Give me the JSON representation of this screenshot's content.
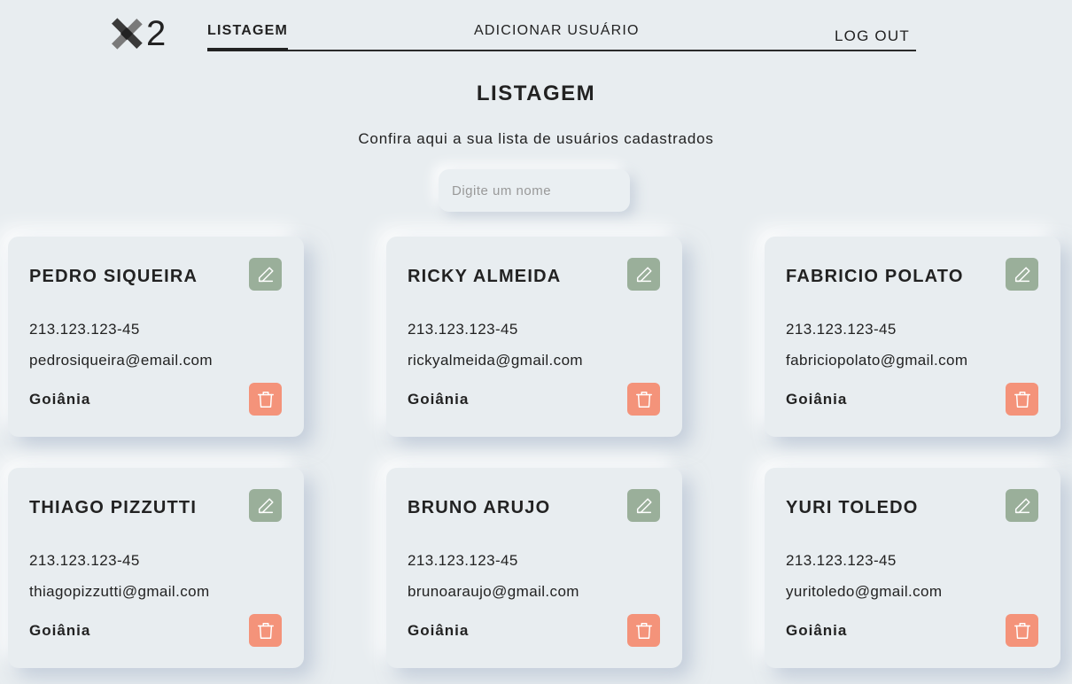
{
  "logo": {
    "text": "2"
  },
  "nav": {
    "items": [
      {
        "label": "LISTAGEM",
        "active": true
      },
      {
        "label": "ADICIONAR USUÁRIO",
        "active": false
      }
    ],
    "logout_label": "LOG OUT"
  },
  "page": {
    "title": "LISTAGEM",
    "subtitle": "Confira aqui a sua lista de usuários cadastrados"
  },
  "search": {
    "placeholder": "Digite um nome",
    "value": ""
  },
  "users": [
    {
      "name": "PEDRO SIQUEIRA",
      "phone": "213.123.123-45",
      "email": "pedrosiqueira@email.com",
      "city": "Goiânia"
    },
    {
      "name": "RICKY ALMEIDA",
      "phone": "213.123.123-45",
      "email": "rickyalmeida@gmail.com",
      "city": "Goiânia"
    },
    {
      "name": "FABRICIO POLATO",
      "phone": "213.123.123-45",
      "email": "fabriciopolato@gmail.com",
      "city": "Goiânia"
    },
    {
      "name": "THIAGO PIZZUTTI",
      "phone": "213.123.123-45",
      "email": "thiagopizzutti@gmail.com",
      "city": "Goiânia"
    },
    {
      "name": "BRUNO ARUJO",
      "phone": "213.123.123-45",
      "email": "brunoaraujo@gmail.com",
      "city": "Goiânia"
    },
    {
      "name": "YURI TOLEDO",
      "phone": "213.123.123-45",
      "email": "yuritoledo@gmail.com",
      "city": "Goiânia"
    }
  ],
  "colors": {
    "background": "#e8edf0",
    "edit_button": "#9aaf9a",
    "delete_button": "#f4937a",
    "text": "#222222"
  },
  "icons": {
    "edit": "pencil-icon",
    "delete": "trash-icon"
  }
}
